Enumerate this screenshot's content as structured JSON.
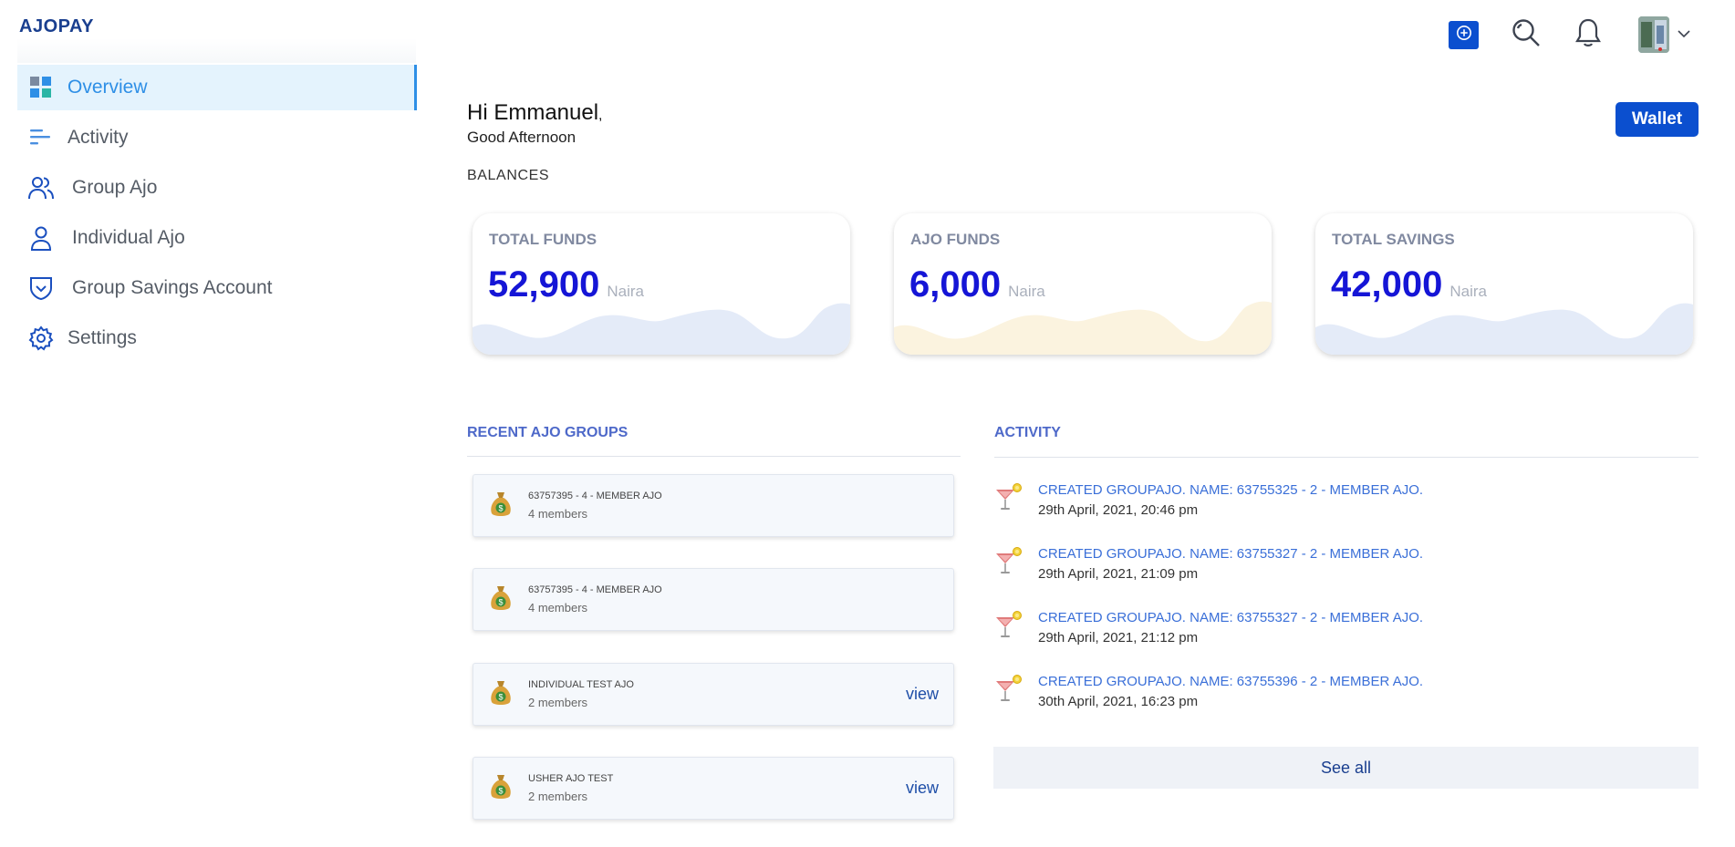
{
  "app": {
    "logo": "AJOPAY"
  },
  "sidebar": {
    "items": [
      {
        "label": "Overview",
        "icon": "grid-icon",
        "active": true
      },
      {
        "label": "Activity",
        "icon": "activity-lines-icon",
        "active": false
      },
      {
        "label": "Group Ajo",
        "icon": "users-icon",
        "active": false
      },
      {
        "label": "Individual Ajo",
        "icon": "user-icon",
        "active": false
      },
      {
        "label": "Group Savings Account",
        "icon": "shield-check-icon",
        "active": false
      },
      {
        "label": "Settings",
        "icon": "gear-icon",
        "active": false
      }
    ]
  },
  "topbar": {
    "icons": [
      "plus-circle-icon",
      "search-icon",
      "bell-icon",
      "avatar",
      "chevron-down-icon"
    ]
  },
  "greeting": {
    "name": "Hi Emmanuel",
    "punct": ",",
    "subtitle": "Good Afternoon",
    "wallet_button": "Wallet"
  },
  "balances": {
    "label": "BALANCES",
    "cards": [
      {
        "title": "TOTAL FUNDS",
        "amount": "52,900",
        "unit": "Naira",
        "wave_color": "#e4ebf8"
      },
      {
        "title": "AJO FUNDS",
        "amount": "6,000",
        "unit": "Naira",
        "wave_color": "#fbf3df"
      },
      {
        "title": "TOTAL SAVINGS",
        "amount": "42,000",
        "unit": "Naira",
        "wave_color": "#e4ebf8"
      }
    ]
  },
  "recent_groups": {
    "title": "RECENT AJO GROUPS",
    "items": [
      {
        "name": "63757395 - 4 - MEMBER AJO",
        "members": "4 members",
        "view": ""
      },
      {
        "name": "63757395 - 4 - MEMBER AJO",
        "members": "4 members",
        "view": ""
      },
      {
        "name": "INDIVIDUAL TEST AJO",
        "members": "2 members",
        "view": "view"
      },
      {
        "name": "USHER AJO TEST",
        "members": "2 members",
        "view": "view"
      }
    ]
  },
  "activity": {
    "title": "ACTIVITY",
    "items": [
      {
        "text": "CREATED GROUPAJO. NAME: 63755325 - 2 - MEMBER AJO.",
        "date": "29th April, 2021, 20:46 pm"
      },
      {
        "text": "CREATED GROUPAJO. NAME: 63755327 - 2 - MEMBER AJO.",
        "date": "29th April, 2021, 21:09 pm"
      },
      {
        "text": "CREATED GROUPAJO. NAME: 63755327 - 2 - MEMBER AJO.",
        "date": "29th April, 2021, 21:12 pm"
      },
      {
        "text": "CREATED GROUPAJO. NAME: 63755396 - 2 - MEMBER AJO.",
        "date": "30th April, 2021, 16:23 pm"
      }
    ],
    "see_all": "See all"
  },
  "colors": {
    "primary": "#0b4fcf",
    "active_nav": "#2e8fe6",
    "amount": "#1515d6",
    "section_title": "#4e69c9",
    "link": "#3a6fd8"
  }
}
